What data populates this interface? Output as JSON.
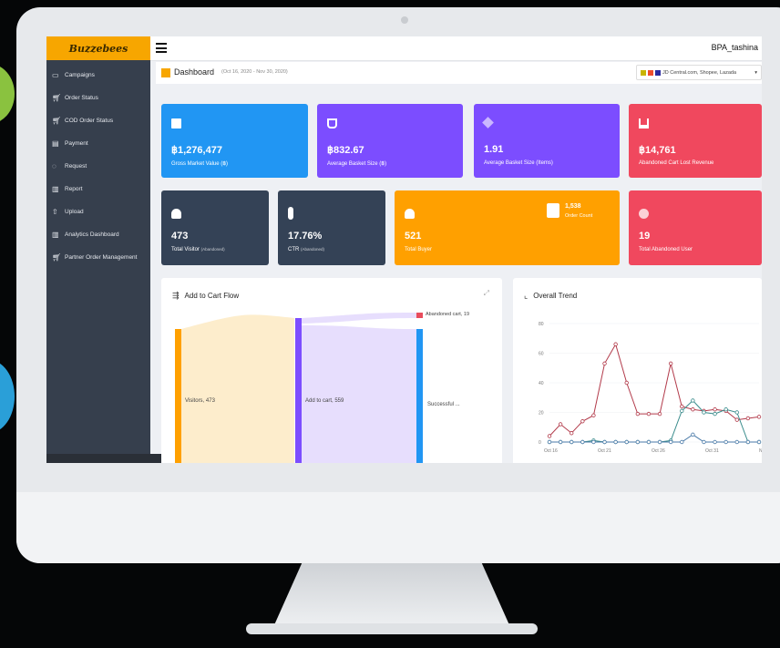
{
  "app": {
    "logo": "Buzzebees",
    "user": "BPA_tashina"
  },
  "sidebar": {
    "items": [
      {
        "label": "Campaigns",
        "icon": "document-icon"
      },
      {
        "label": "Order Status",
        "icon": "cart-icon"
      },
      {
        "label": "COD Order Status",
        "icon": "cart-icon"
      },
      {
        "label": "Payment",
        "icon": "credit-card-icon"
      },
      {
        "label": "Request",
        "icon": "chat-icon"
      },
      {
        "label": "Report",
        "icon": "bar-chart-icon"
      },
      {
        "label": "Upload",
        "icon": "upload-icon"
      },
      {
        "label": "Analytics Dashboard",
        "icon": "bar-chart-icon"
      },
      {
        "label": "Partner Order Management",
        "icon": "cart-icon"
      }
    ]
  },
  "header": {
    "title": "Dashboard",
    "date_range": "(Oct 16, 2020 - Nov 30, 2020)",
    "marketplaces": "JD Central.com, Shopee, Lazada"
  },
  "cards_top": [
    {
      "value": "฿1,276,477",
      "label": "Gross Market Value (฿)",
      "color": "#2196f3",
      "icon": "wallet-icon"
    },
    {
      "value": "฿832.67",
      "label": "Average Basket Size (฿)",
      "color": "#7c4dff",
      "icon": "basket-icon"
    },
    {
      "value": "1.91",
      "label": "Average Basket Size (Items)",
      "color": "#7c4dff",
      "icon": "tag-icon"
    },
    {
      "value": "฿14,761",
      "label": "Abandoned Cart Lost Revenue",
      "color": "#f0485e",
      "icon": "cart-down-icon"
    }
  ],
  "cards_bottom": [
    {
      "value": "473",
      "label": "Total Visitor",
      "sub": "(Abandoned)",
      "color": "#344256",
      "icon": "users-icon"
    },
    {
      "value": "17.76%",
      "label": "CTR",
      "sub": "(Abandoned)",
      "color": "#344256",
      "icon": "click-icon"
    },
    {
      "value": "521",
      "label": "Total Buyer",
      "color": "#ffa000",
      "icon": "buyer-icon",
      "order_count": "1,538",
      "order_label": "Order Count"
    },
    {
      "value": "19",
      "label": "Total Abandoned User",
      "color": "#f0485e",
      "icon": "sad-user-icon"
    }
  ],
  "flow": {
    "title": "Add to Cart Flow",
    "nodes": [
      {
        "label": "Visitors, 473",
        "color": "#ffa000"
      },
      {
        "label": "Add to cart, 559",
        "color": "#7c4dff"
      },
      {
        "label": "Successful ...",
        "color": "#2196f3"
      },
      {
        "label": "Abandoned cart, 19",
        "color": "#e84c5c"
      }
    ]
  },
  "trend": {
    "title": "Overall Trend",
    "chart_data": {
      "type": "line",
      "y_ticks": [
        "80",
        "60",
        "40",
        "20",
        "0"
      ],
      "x_ticks": [
        "Oct 16",
        "Oct 21",
        "Oct 26",
        "Oct 31",
        "Nov"
      ],
      "ylim": [
        0,
        80
      ],
      "series": [
        {
          "color": "#b23a4a",
          "values": [
            4,
            12,
            6,
            14,
            18,
            53,
            66,
            40,
            19,
            19,
            19,
            53,
            24,
            22,
            21,
            22,
            21,
            15,
            16,
            17
          ]
        },
        {
          "color": "#3a8c8c",
          "values": [
            0,
            0,
            0,
            0,
            1,
            0,
            0,
            0,
            0,
            0,
            0,
            1,
            21,
            28,
            20,
            19,
            22,
            20,
            0,
            0
          ]
        },
        {
          "color": "#4a7aa8",
          "values": [
            0,
            0,
            0,
            0,
            0,
            0,
            0,
            0,
            0,
            0,
            0,
            0,
            0,
            5,
            0,
            0,
            0,
            0,
            0,
            0
          ]
        }
      ]
    }
  }
}
